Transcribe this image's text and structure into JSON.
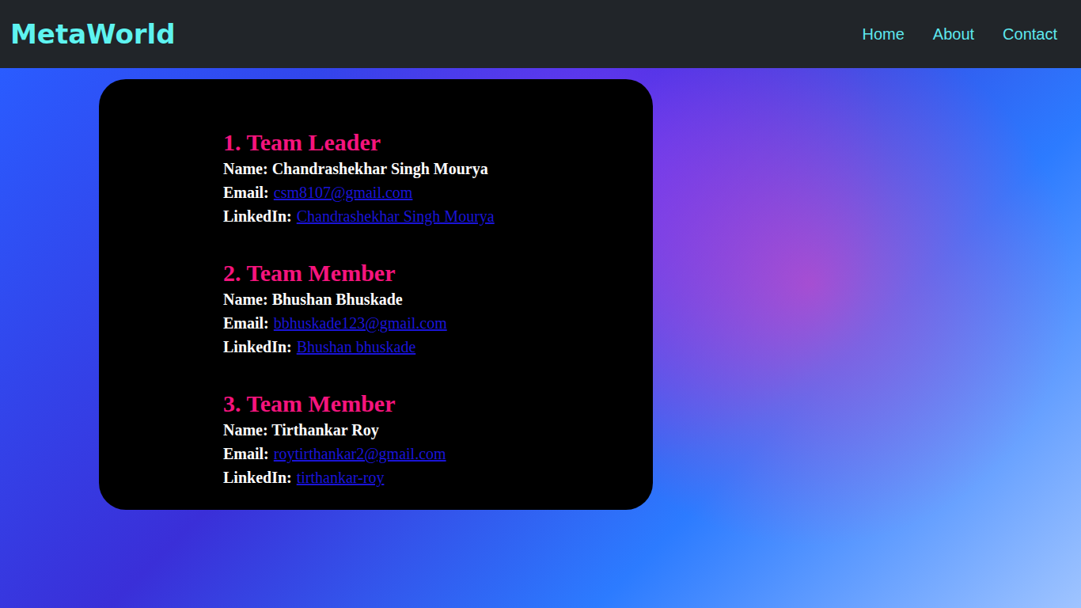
{
  "nav": {
    "logo": "MetaWorld",
    "links": [
      "Home",
      "About",
      "Contact"
    ]
  },
  "members": [
    {
      "heading": "1. Team Leader",
      "name": "Name: Chandrashekhar Singh Mourya",
      "email_label": "Email:",
      "email": "csm8107@gmail.com",
      "linkedin_label": "LinkedIn:",
      "linkedin": "Chandrashekhar Singh Mourya"
    },
    {
      "heading": "2. Team Member",
      "name": "Name: Bhushan Bhuskade",
      "email_label": "Email:",
      "email": "bbhuskade123@gmail.com",
      "linkedin_label": "LinkedIn:",
      "linkedin": "Bhushan bhuskade"
    },
    {
      "heading": "3. Team Member",
      "name": "Name: Tirthankar Roy",
      "email_label": "Email:",
      "email": "roytirthankar2@gmail.com",
      "linkedin_label": "LinkedIn:",
      "linkedin": "tirthankar-roy"
    }
  ]
}
